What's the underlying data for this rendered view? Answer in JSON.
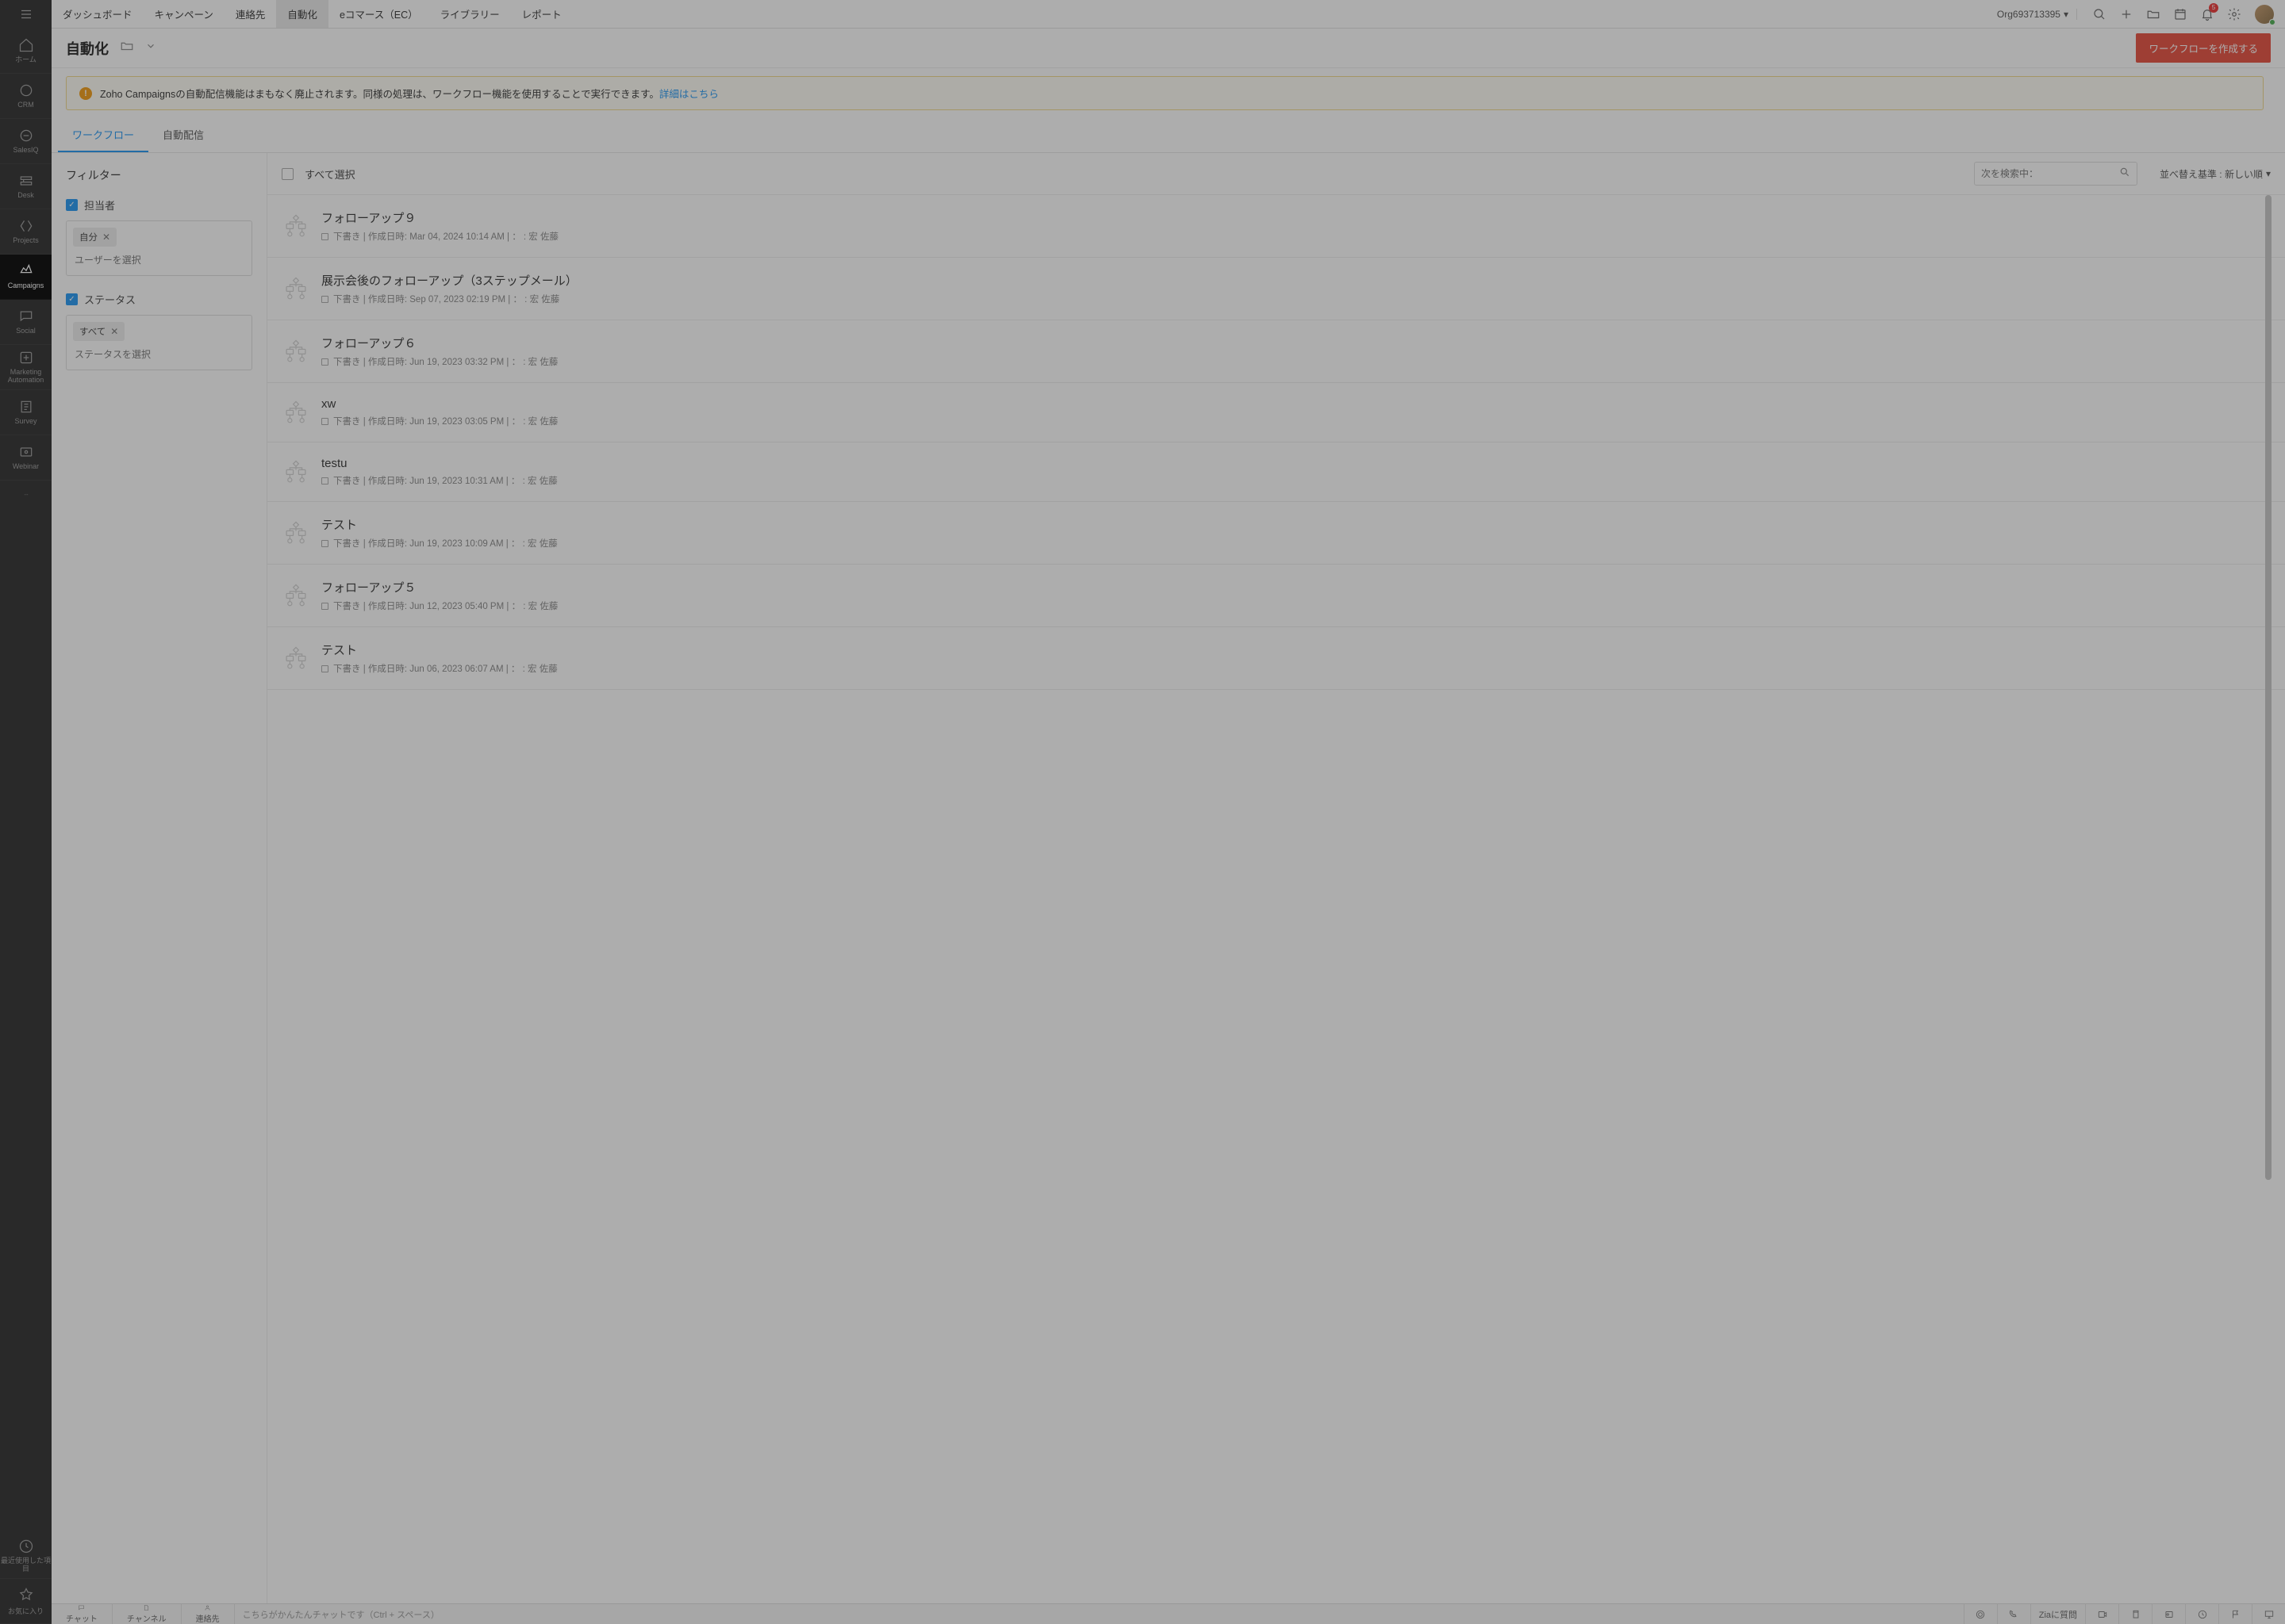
{
  "topNav": {
    "tabs": [
      "ダッシュボード",
      "キャンペーン",
      "連絡先",
      "自動化",
      "eコマース（EC）",
      "ライブラリー",
      "レポート"
    ],
    "activeIndex": 3,
    "org": "Org693713395",
    "notifCount": "5"
  },
  "sideNav": {
    "items": [
      {
        "label": "ホーム"
      },
      {
        "label": "CRM"
      },
      {
        "label": "SalesIQ"
      },
      {
        "label": "Desk"
      },
      {
        "label": "Projects"
      },
      {
        "label": "Campaigns"
      },
      {
        "label": "Social"
      },
      {
        "label": "Marketing Automation"
      },
      {
        "label": "Survey"
      },
      {
        "label": "Webinar"
      }
    ],
    "activeIndex": 5,
    "recent": "最近使用した項目",
    "favorites": "お気に入り"
  },
  "page": {
    "title": "自動化",
    "createBtn": "ワークフローを作成する"
  },
  "notice": {
    "text": "Zoho Campaignsの自動配信機能はまもなく廃止されます。同様の処理は、ワークフロー機能を使用することで実行できます。",
    "link": "詳細はこちら"
  },
  "subTabs": {
    "items": [
      "ワークフロー",
      "自動配信"
    ],
    "activeIndex": 0
  },
  "filter": {
    "title": "フィルター",
    "assignee": {
      "label": "担当者",
      "chip": "自分",
      "placeholder": "ユーザーを選択"
    },
    "status": {
      "label": "ステータス",
      "chip": "すべて",
      "placeholder": "ステータスを選択"
    }
  },
  "listHeader": {
    "selectAll": "すべて選択",
    "searchPlaceholder": "次を検索中：",
    "sort": "並べ替え基準 : 新しい順"
  },
  "workflows": [
    {
      "title": "フォローアップ９",
      "status": "下書き",
      "created": "作成日時: Mar 04, 2024 10:14 AM",
      "owner": "宏 佐藤"
    },
    {
      "title": "展示会後のフォローアップ（3ステップメール）",
      "status": "下書き",
      "created": "作成日時: Sep 07, 2023 02:19 PM",
      "owner": "宏 佐藤"
    },
    {
      "title": "フォローアップ６",
      "status": "下書き",
      "created": "作成日時: Jun 19, 2023 03:32 PM",
      "owner": "宏 佐藤"
    },
    {
      "title": "xw",
      "status": "下書き",
      "created": "作成日時: Jun 19, 2023 03:05 PM",
      "owner": "宏 佐藤"
    },
    {
      "title": "testu",
      "status": "下書き",
      "created": "作成日時: Jun 19, 2023 10:31 AM",
      "owner": "宏 佐藤"
    },
    {
      "title": "テスト",
      "status": "下書き",
      "created": "作成日時: Jun 19, 2023 10:09 AM",
      "owner": "宏 佐藤"
    },
    {
      "title": "フォローアップ５",
      "status": "下書き",
      "created": "作成日時: Jun 12, 2023 05:40 PM",
      "owner": "宏 佐藤"
    },
    {
      "title": "テスト",
      "status": "下書き",
      "created": "作成日時: Jun 06, 2023 06:07 AM",
      "owner": "宏 佐藤"
    }
  ],
  "bottomBar": {
    "chat": "チャット",
    "channel": "チャンネル",
    "contacts": "連絡先",
    "inputPlaceholder": "こちらがかんたんチャットです（Ctrl + スペース）",
    "zia": "Ziaに質問"
  }
}
